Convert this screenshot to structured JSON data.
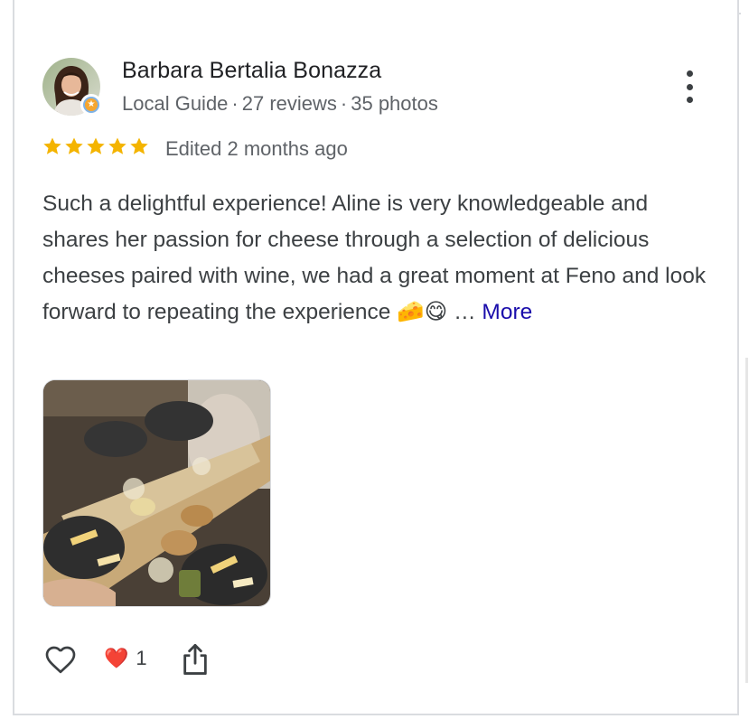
{
  "reviewer": {
    "name": "Barbara Bertalia Bonazza",
    "meta": [
      "Local Guide",
      "·",
      "27 reviews",
      "·",
      "35 photos"
    ]
  },
  "rating": {
    "stars": 5,
    "max": 5,
    "edited": "Edited 2 months ago",
    "color": "#f4b400"
  },
  "review": {
    "text": "Such a delightful experience! Aline is very knowledgeable and shares her passion for cheese through a selection of delicious cheeses paired with wine, we had a great moment at Feno and look forward to repeating the experience ",
    "emoji": "🧀😋",
    "ellipsis": " … ",
    "more_label": "More"
  },
  "actions": {
    "reaction_emoji": "❤️",
    "reaction_count": "1"
  },
  "icons": {
    "menu": "more-vert-icon",
    "like": "heart-outline-icon",
    "share": "share-icon",
    "badge": "local-guide-badge-icon"
  }
}
